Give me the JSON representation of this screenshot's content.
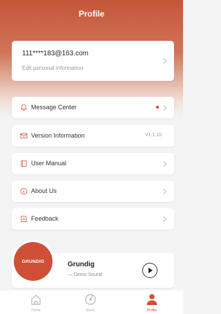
{
  "header": {
    "title": "Profile"
  },
  "profile": {
    "email": "111****183@163.com",
    "edit_label": "Edit personal information"
  },
  "menu": [
    {
      "id": "message-center",
      "label": "Message Center",
      "icon": "bell-icon",
      "badge": "red-dot"
    },
    {
      "id": "version-information",
      "label": "Version Information",
      "icon": "envelope-icon",
      "value": "V1.1.10"
    },
    {
      "id": "user-manual",
      "label": "User Manual",
      "icon": "book-icon"
    },
    {
      "id": "about-us",
      "label": "About Us",
      "icon": "info-icon"
    },
    {
      "id": "feedback",
      "label": "Feedback",
      "icon": "feedback-icon"
    }
  ],
  "player": {
    "disc_label": "GRUNDIG",
    "title": "Grundig",
    "subtitle": "— Demo Sound"
  },
  "tabs": [
    {
      "label": "Home",
      "icon": "home-icon"
    },
    {
      "label": "Music",
      "icon": "music-icon"
    },
    {
      "label": "Profile",
      "icon": "person-icon",
      "active": true
    }
  ],
  "colors": {
    "accent": "#cf4f37",
    "header_top": "#c6553a",
    "badge": "#e53935"
  }
}
